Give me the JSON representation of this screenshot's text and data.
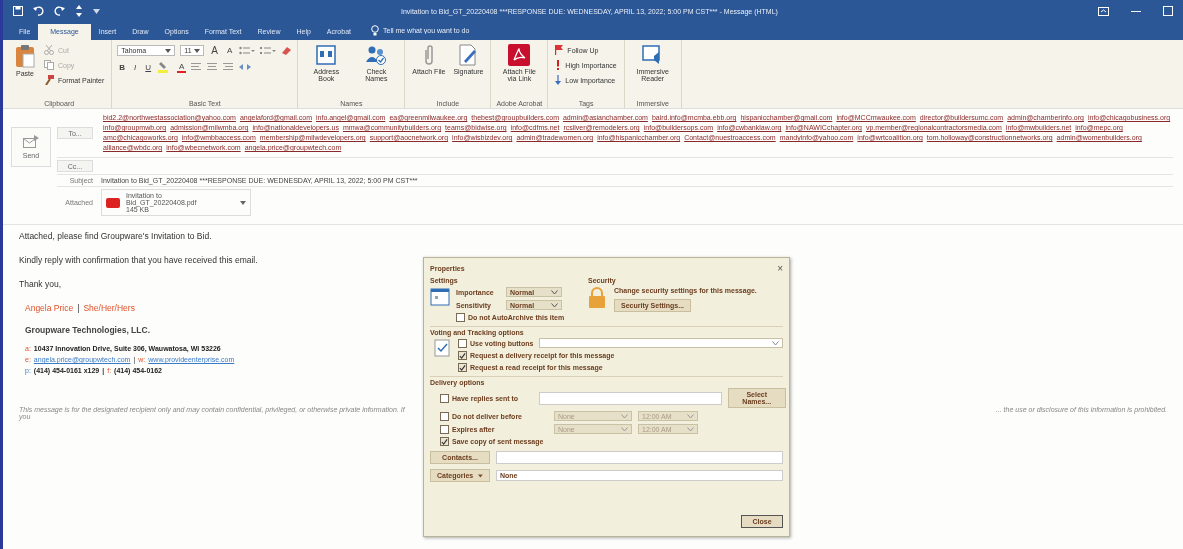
{
  "window": {
    "title": "Invitation to Bid_GT_20220408 ***RESPONSE DUE: WEDNESDAY, APRIL 13, 2022; 5:00 PM CST*** - Message (HTML)"
  },
  "tabs": [
    {
      "label": "File",
      "selected": false
    },
    {
      "label": "Message",
      "selected": true
    },
    {
      "label": "Insert",
      "selected": false
    },
    {
      "label": "Draw",
      "selected": false
    },
    {
      "label": "Options",
      "selected": false
    },
    {
      "label": "Format Text",
      "selected": false
    },
    {
      "label": "Review",
      "selected": false
    },
    {
      "label": "Help",
      "selected": false
    },
    {
      "label": "Acrobat",
      "selected": false
    }
  ],
  "tell_me": {
    "placeholder": "Tell me what you want to do"
  },
  "ribbon": {
    "groups": [
      {
        "label": "Clipboard",
        "kind": "clipboard",
        "items": [
          {
            "label": "Paste",
            "kind": "paste"
          },
          {
            "label": "Cut",
            "kind": "cut",
            "disabled": true
          },
          {
            "label": "Copy",
            "kind": "copy",
            "disabled": true
          },
          {
            "label": "Format Painter",
            "kind": "painter",
            "disabled": false
          }
        ]
      },
      {
        "label": "Basic Text",
        "kind": "basic-text",
        "font": "Tahoma",
        "size": "11",
        "grow": "A",
        "shrink": "A",
        "styles": [
          "B",
          "I",
          "U"
        ],
        "font_color": "A"
      },
      {
        "label": "Names",
        "kind": "buttons",
        "items": [
          {
            "label": "Address Book",
            "kind": "address-book"
          },
          {
            "label": "Check Names",
            "kind": "check-names"
          }
        ]
      },
      {
        "label": "Include",
        "kind": "buttons",
        "items": [
          {
            "label": "Attach File",
            "kind": "attach"
          },
          {
            "label": "Signature",
            "kind": "signature"
          }
        ]
      },
      {
        "label": "Adobe Acrobat",
        "kind": "buttons",
        "items": [
          {
            "label": "Attach File via Link",
            "kind": "acrobat"
          }
        ]
      },
      {
        "label": "Tags",
        "kind": "tags",
        "items": [
          {
            "label": "Follow Up",
            "kind": "flag"
          },
          {
            "label": "High Importance",
            "kind": "high"
          },
          {
            "label": "Low Importance",
            "kind": "low"
          }
        ]
      },
      {
        "label": "Immersive",
        "kind": "buttons",
        "items": [
          {
            "label": "Immersive Reader",
            "kind": "reader"
          }
        ]
      }
    ]
  },
  "header": {
    "send": "Send",
    "to_button": "To...",
    "cc_button": "Cc...",
    "subject_label": "Subject",
    "attached_label": "Attached",
    "to": [
      "bid2.2@northwestassociation@yahoo.com",
      "angelaford@gmail.com",
      "info.angel@gmail.com",
      "ea@greenmilwaukee.org",
      "thebest@groupbuilders.com",
      "admin@asianchamber.com",
      "baird.info@mcmba.ebb.org",
      "hispanicchamber@gmail.com",
      "info@MCCmwaukee.com",
      "director@buildersumc.com",
      "admin@chamberinfo.org",
      "info@chicagobusiness.org",
      "info@groupmwb.org",
      "admission@milwmba.org",
      "info@nationaldevelopers.us",
      "mmwa@communitybuilders.org",
      "teams@bidwise.org",
      "info@cdfms.net",
      "rcsilver@remodelers.org",
      "info@buildersops.com",
      "info@cwbanklaw.org",
      "info@NAWICchapter.org",
      "vp.member@regionalcontractorsmedia.com",
      "info@mwbuilders.net",
      "info@mepc.org",
      "amc@chicagoworks.org",
      "info@wmbbaccess.com",
      "membership@milwdevelopers.org",
      "support@aocnetwork.org",
      "info@wisbizdev.org",
      "admin@tradewomen.org",
      "info@hispanicchamber.org",
      "Contact@nuestroaccess.com",
      "mandyinfo@yahoo.com",
      "info@wrtcoalition.org",
      "tom.holloway@constructionnetworks.org",
      "admin@womenbuilders.org",
      "alliance@wbdc.org",
      "info@wbecnetwork.com",
      "angela.price@groupwtech.com"
    ],
    "subject": "Invitation to Bid_GT_20220408 ***RESPONSE DUE: WEDNESDAY, APRIL 13, 2022; 5:00 PM CST***",
    "attachment": {
      "name": "Invitation to Bid_GT_20220408.pdf",
      "size": "145 KB"
    }
  },
  "body": {
    "paragraphs": [
      "Attached, please find Groupware's Invitation to Bid.",
      "Kindly reply with confirmation that you have received this email.",
      "Thank you,"
    ],
    "signature": {
      "name": "Angela Price",
      "separator": "|",
      "pronouns": "She/Her/Hers",
      "company": "Groupware Technologies, LLC.",
      "lines": [
        [
          {
            "kind": "label",
            "text": "a:"
          },
          {
            "kind": "text",
            "text": "10437 Innovation Drive, Suite 306, Wauwatosa, WI 53226"
          }
        ],
        [
          {
            "kind": "label",
            "text": "e:"
          },
          {
            "kind": "link",
            "text": "angela.price@groupwtech.com"
          },
          {
            "kind": "sep",
            "text": "|"
          },
          {
            "kind": "label",
            "text": "w:"
          },
          {
            "kind": "link",
            "text": "www.provideenterprise.com"
          }
        ],
        [
          {
            "kind": "label-blue",
            "text": "p:"
          },
          {
            "kind": "text",
            "text": "(414) 454-0161 x129"
          },
          {
            "kind": "sep-bold",
            "text": "|"
          },
          {
            "kind": "label",
            "text": "f:"
          },
          {
            "kind": "text",
            "text": "(414) 454-0162"
          }
        ]
      ]
    },
    "disclaimer_left": "This message is for the designated recipient only and may contain confidential, privileged, or otherwise private information. If you",
    "disclaimer_right": "... the use or disclosure of this information is prohibited."
  },
  "properties_dialog": {
    "title": "Properties",
    "close": "×",
    "settings": {
      "heading": "Settings",
      "importance_label": "Importance",
      "importance": "Normal",
      "sensitivity_label": "Sensitivity",
      "sensitivity": "Normal"
    },
    "security": {
      "heading": "Security",
      "text": "Change security settings for this message.",
      "button": "Security Settings..."
    },
    "autoarchive": {
      "label": "Do not AutoArchive this item",
      "checked": false
    },
    "voting": {
      "heading": "Voting and Tracking options",
      "options": [
        {
          "label": "Use voting buttons",
          "checked": false,
          "kind": "combo"
        },
        {
          "label": "Request a delivery receipt for this message",
          "checked": true,
          "kind": "plain"
        },
        {
          "label": "Request a read receipt for this message",
          "checked": true,
          "kind": "plain"
        }
      ]
    },
    "delivery": {
      "heading": "Delivery options",
      "options": [
        {
          "label": "Have replies sent to",
          "checked": false,
          "kind": "field",
          "button": "Select Names..."
        },
        {
          "label": "Do not deliver before",
          "checked": false,
          "kind": "datetime",
          "date": "None",
          "time": "12:00 AM"
        },
        {
          "label": "Expires after",
          "checked": false,
          "kind": "datetime",
          "date": "None",
          "time": "12:00 AM"
        },
        {
          "label": "Save copy of sent message",
          "checked": true,
          "kind": "plain"
        }
      ]
    },
    "contacts_button": "Contacts...",
    "categories_button": "Categories",
    "categories_value": "None",
    "close_button": "Close"
  }
}
